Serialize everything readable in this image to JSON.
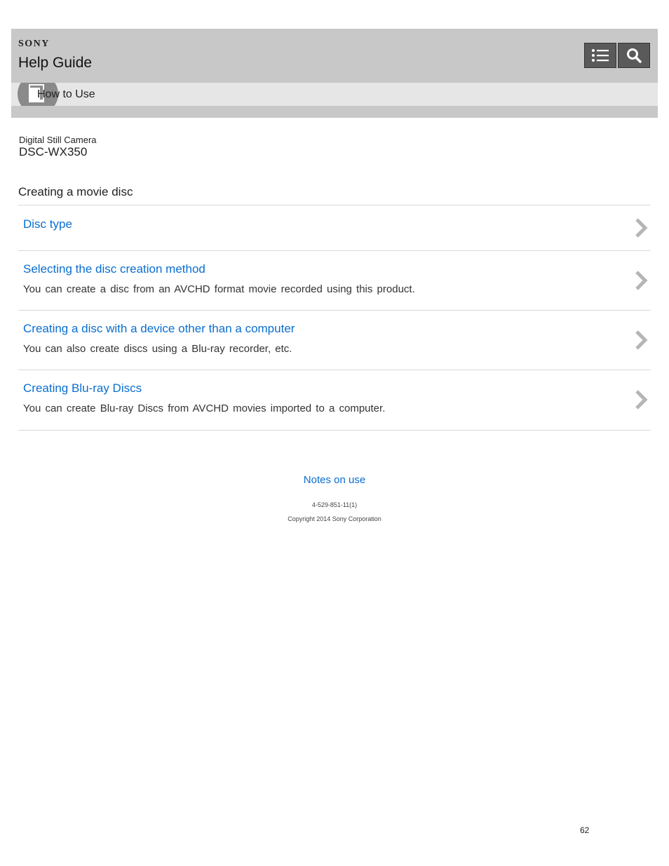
{
  "header": {
    "brand": "SONY",
    "title": "Help Guide",
    "menu_icon": "list-menu-icon",
    "search_icon": "search-icon"
  },
  "category": {
    "label": "How to Use",
    "icon": "how-to-use-icon"
  },
  "product": {
    "category": "Digital Still Camera",
    "model": "DSC-WX350"
  },
  "page_title": "Creating a movie disc",
  "items": [
    {
      "title": "Disc type",
      "description": ""
    },
    {
      "title": "Selecting the disc creation method",
      "description": "You can create a disc from an AVCHD format movie recorded using this product."
    },
    {
      "title": "Creating a disc with a device other than a computer",
      "description": "You can also create discs using a Blu-ray recorder, etc."
    },
    {
      "title": "Creating Blu-ray Discs",
      "description": "You can create Blu-ray Discs from AVCHD movies imported to a computer."
    }
  ],
  "footer": {
    "notes_link": "Notes on use",
    "doc_number": "4-529-851-11(1)",
    "copyright": "Copyright 2014 Sony Corporation"
  },
  "page_number": "62",
  "colors": {
    "link": "#0a6ed1",
    "header_bg": "#c8c8c8",
    "subbar_bg": "#e6e6e6"
  }
}
